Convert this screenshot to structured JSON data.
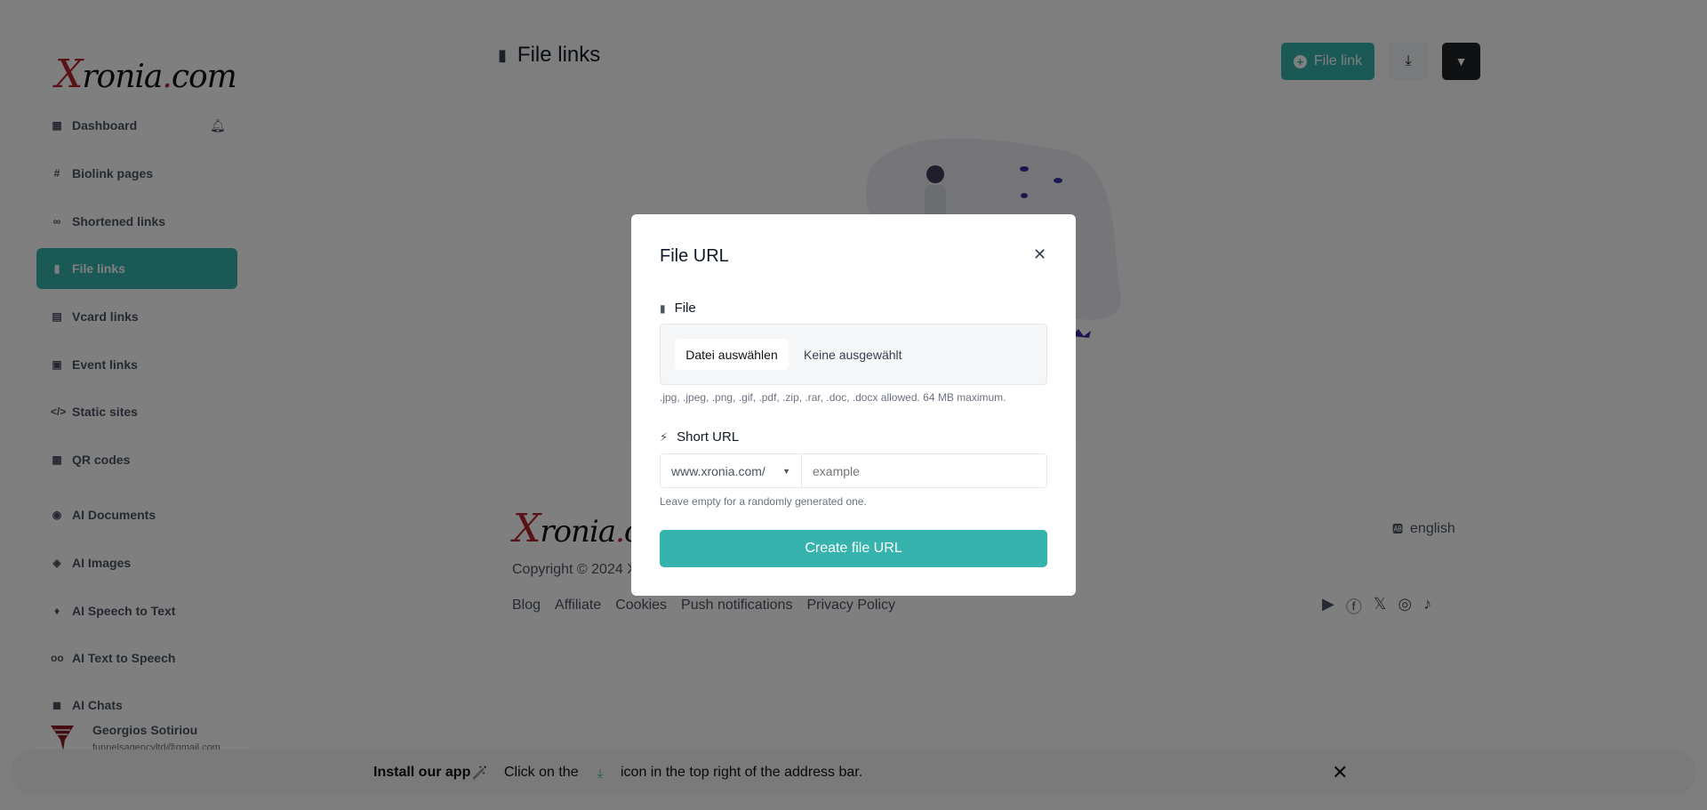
{
  "brand": {
    "logo_text": "Xronia.com"
  },
  "sidebar": {
    "items": [
      {
        "label": "Dashboard",
        "icon": "table-icon"
      },
      {
        "label": "Biolink pages",
        "icon": "hashtag-icon"
      },
      {
        "label": "Shortened links",
        "icon": "link-icon"
      },
      {
        "label": "File links",
        "icon": "file-icon",
        "active": true
      },
      {
        "label": "Vcard links",
        "icon": "id-card-icon"
      },
      {
        "label": "Event links",
        "icon": "calendar-icon"
      },
      {
        "label": "Static sites",
        "icon": "code-icon"
      },
      {
        "label": "QR codes",
        "icon": "qrcode-icon"
      },
      {
        "label": "AI Documents",
        "icon": "robot-icon"
      },
      {
        "label": "AI Images",
        "icon": "icons-icon"
      },
      {
        "label": "AI Speech to Text",
        "icon": "microphone-icon"
      },
      {
        "label": "AI Text to Speech",
        "icon": "voicemail-icon"
      },
      {
        "label": "AI Chats",
        "icon": "comments-icon"
      }
    ],
    "user": {
      "name": "Georgios Sotiriou",
      "email": "funnelsagencyltd@gmail.com"
    }
  },
  "header": {
    "title": "File links",
    "add_button": "File link"
  },
  "footer": {
    "copyright": "Copyright © 2024 X",
    "language": "english",
    "links": [
      "Blog",
      "Affiliate",
      "Cookies",
      "Push notifications",
      "Privacy Policy"
    ]
  },
  "install": {
    "title": "Install our app",
    "text_before": "Click on the",
    "text_after": "icon in the top right of the address bar."
  },
  "modal": {
    "title": "File URL",
    "file_label": "File",
    "file_button": "Datei auswählen",
    "file_status": "Keine ausgewählt",
    "file_help": ".jpg, .jpeg, .png, .gif, .pdf, .zip, .rar, .doc, .docx allowed. 64 MB maximum.",
    "short_label": "Short URL",
    "domain": "www.xronia.com/",
    "placeholder": "example",
    "short_help": "Leave empty for a randomly generated one.",
    "submit": "Create file URL"
  },
  "colors": {
    "accent": "#37b3ad",
    "dark": "#1f2327"
  }
}
